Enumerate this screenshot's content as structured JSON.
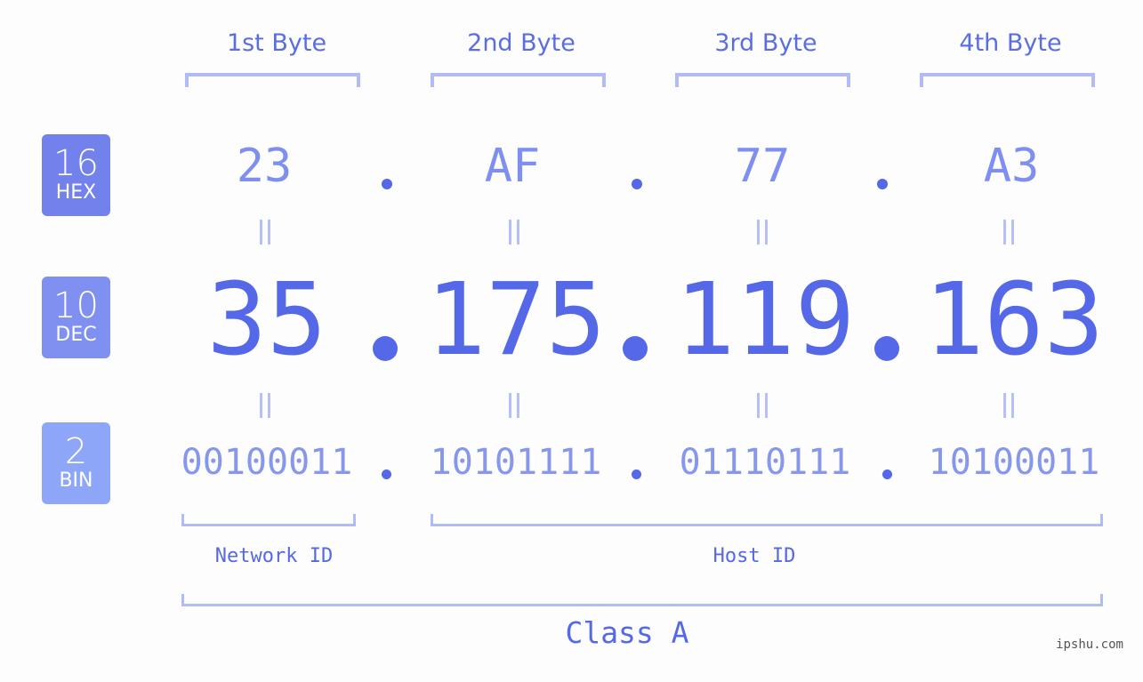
{
  "bytes": {
    "labels": [
      "1st Byte",
      "2nd Byte",
      "3rd Byte",
      "4th Byte"
    ],
    "hex": [
      "23",
      "AF",
      "77",
      "A3"
    ],
    "dec": [
      "35",
      "175",
      "119",
      "163"
    ],
    "bin": [
      "00100011",
      "10101111",
      "01110111",
      "10100011"
    ]
  },
  "badges": {
    "hex": {
      "num": "16",
      "label": "HEX",
      "color": "#7281eb"
    },
    "dec": {
      "num": "10",
      "label": "DEC",
      "color": "#8090f1"
    },
    "bin": {
      "num": "2",
      "label": "BIN",
      "color": "#8ea6f8"
    }
  },
  "ip": {
    "dotted_decimal": "35.175.119.163",
    "network_id_label": "Network ID",
    "host_id_label": "Host ID",
    "class_label": "Class A"
  },
  "watermark": "ipshu.com",
  "colors": {
    "accent": "#5468e8",
    "bracket": "#b1bbf6",
    "hex_text": "#7f8ff0",
    "bin_text": "#8797ee"
  }
}
